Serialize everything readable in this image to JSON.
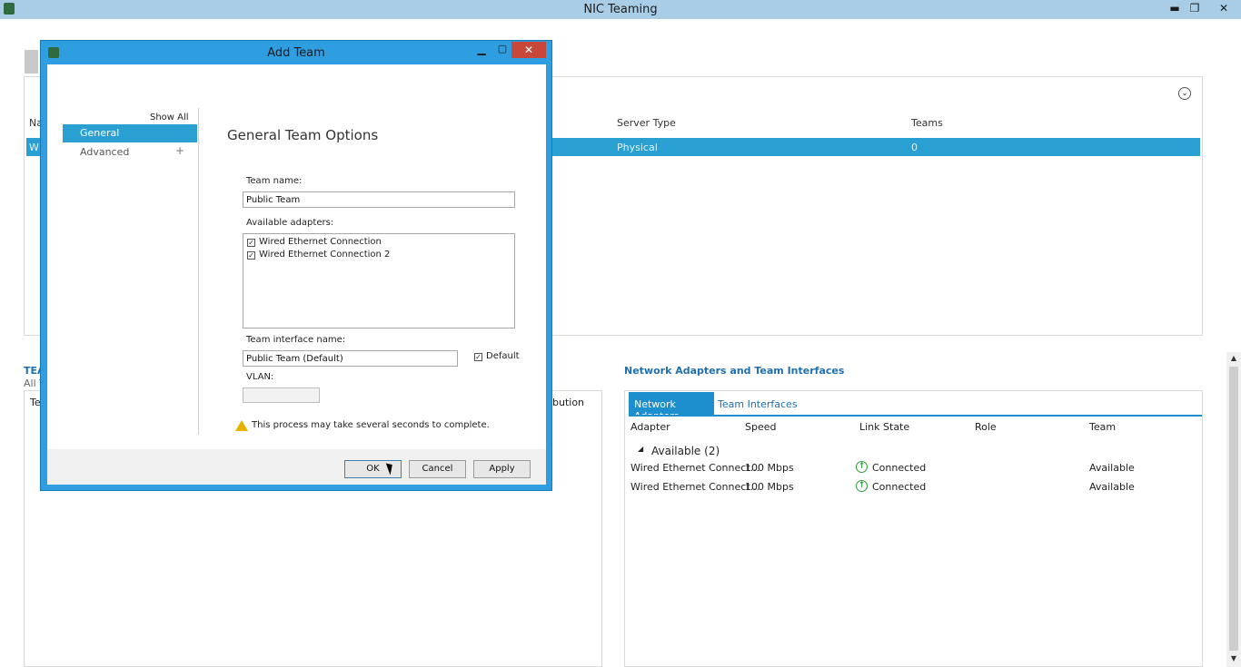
{
  "window": {
    "title": "NIC Teaming",
    "minimize": "▬",
    "restore": "❐",
    "close": "✕"
  },
  "servers": {
    "col_server_type": "Server Type",
    "col_teams": "Teams",
    "row_server_type": "Physical",
    "row_teams": "0",
    "col_name_partial": "Na",
    "row_name_partial": "WI"
  },
  "teams_panel": {
    "title_partial": "TEA",
    "subtitle_partial": "All T",
    "col_partial": "Te",
    "distribution_partial": "bution"
  },
  "adapters_panel": {
    "title": "Network Adapters and Team Interfaces",
    "tabs": [
      "Network Adapters",
      "Team Interfaces"
    ],
    "columns": [
      "Adapter",
      "Speed",
      "Link State",
      "Role",
      "Team"
    ],
    "group": "Available (2)",
    "rows": [
      {
        "adapter": "Wired Ethernet Connect...",
        "speed": "100 Mbps",
        "link_state": "Connected",
        "role": "",
        "team": "Available"
      },
      {
        "adapter": "Wired Ethernet Connect...",
        "speed": "100 Mbps",
        "link_state": "Connected",
        "role": "",
        "team": "Available"
      }
    ]
  },
  "dialog": {
    "title": "Add Team",
    "nav": {
      "show_all": "Show All",
      "general": "General",
      "advanced": "Advanced",
      "advanced_expand": "+"
    },
    "heading": "General Team Options",
    "team_name_label": "Team name:",
    "team_name_value": "Public Team",
    "available_adapters_label": "Available adapters:",
    "adapters": [
      {
        "name": "Wired Ethernet Connection",
        "checked": true
      },
      {
        "name": "Wired Ethernet Connection 2",
        "checked": true
      }
    ],
    "team_interface_label": "Team interface name:",
    "team_interface_value": "Public Team (Default)",
    "default_label": "Default",
    "default_checked": true,
    "vlan_label": "VLAN:",
    "warning": "This process may take several seconds to complete.",
    "buttons": {
      "ok": "OK",
      "cancel": "Cancel",
      "apply": "Apply"
    }
  },
  "colors": {
    "accent": "#2aa0d2",
    "dialog_frame": "#2f9ee0",
    "close_button": "#c7483a",
    "connected": "#2e9a3e"
  }
}
